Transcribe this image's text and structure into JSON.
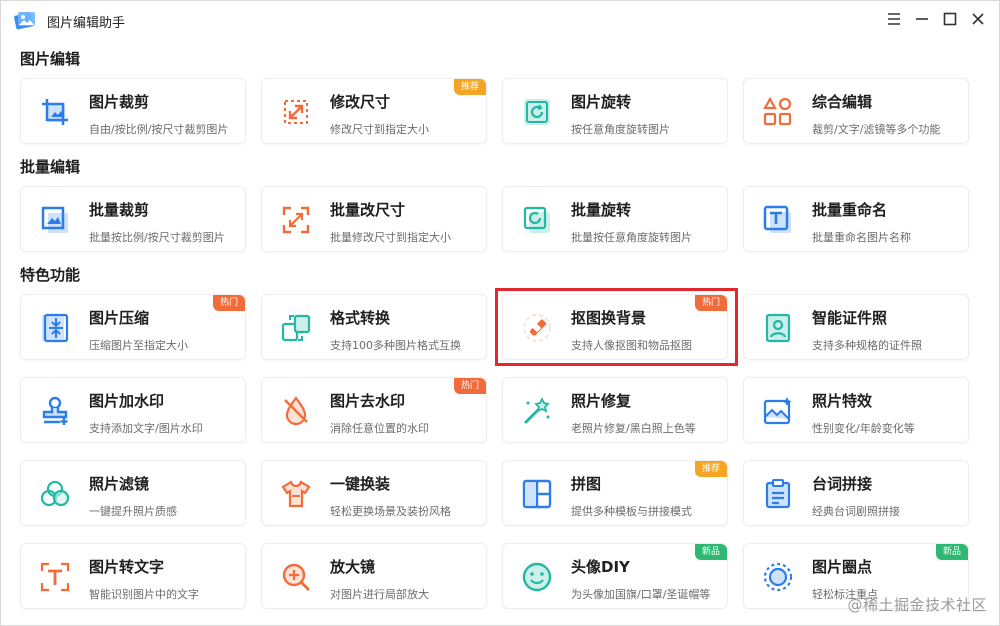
{
  "app": {
    "title": "图片编辑助手"
  },
  "sections": [
    {
      "title": "图片编辑"
    },
    {
      "title": "批量编辑"
    },
    {
      "title": "特色功能"
    }
  ],
  "cards": [
    {
      "name": "图片裁剪",
      "desc": "自由/按比例/按尺寸裁剪图片",
      "icon": "crop-icon"
    },
    {
      "name": "修改尺寸",
      "desc": "修改尺寸到指定大小",
      "icon": "resize-icon",
      "badge": "推荐"
    },
    {
      "name": "图片旋转",
      "desc": "按任意角度旋转图片",
      "icon": "rotate-icon"
    },
    {
      "name": "综合编辑",
      "desc": "裁剪/文字/滤镜等多个功能",
      "icon": "shapes-icon"
    },
    {
      "name": "批量裁剪",
      "desc": "批量按比例/按尺寸裁剪图片",
      "icon": "batch-crop-icon"
    },
    {
      "name": "批量改尺寸",
      "desc": "批量修改尺寸到指定大小",
      "icon": "batch-resize-icon"
    },
    {
      "name": "批量旋转",
      "desc": "批量按任意角度旋转图片",
      "icon": "batch-rotate-icon"
    },
    {
      "name": "批量重命名",
      "desc": "批量重命名图片名称",
      "icon": "rename-icon"
    },
    {
      "name": "图片压缩",
      "desc": "压缩图片至指定大小",
      "icon": "compress-icon",
      "badge": "热门"
    },
    {
      "name": "格式转换",
      "desc": "支持100多种图片格式互换",
      "icon": "convert-icon"
    },
    {
      "name": "抠图换背景",
      "desc": "支持人像抠图和物品抠图",
      "icon": "eraser-icon",
      "badge": "热门"
    },
    {
      "name": "智能证件照",
      "desc": "支持多种规格的证件照",
      "icon": "id-photo-icon"
    },
    {
      "name": "图片加水印",
      "desc": "支持添加文字/图片水印",
      "icon": "stamp-icon"
    },
    {
      "name": "图片去水印",
      "desc": "消除任意位置的水印",
      "icon": "remove-watermark-icon",
      "badge": "热门"
    },
    {
      "name": "照片修复",
      "desc": "老照片修复/黑白照上色等",
      "icon": "magic-wand-icon"
    },
    {
      "name": "照片特效",
      "desc": "性别变化/年龄变化等",
      "icon": "image-effect-icon"
    },
    {
      "name": "照片滤镜",
      "desc": "一键提升照片质感",
      "icon": "filter-icon"
    },
    {
      "name": "一键换装",
      "desc": "轻松更换场景及装扮风格",
      "icon": "tshirt-icon"
    },
    {
      "name": "拼图",
      "desc": "提供多种模板与拼接模式",
      "icon": "collage-icon",
      "badge": "推荐"
    },
    {
      "name": "台词拼接",
      "desc": "经典台词剧照拼接",
      "icon": "clipboard-icon"
    },
    {
      "name": "图片转文字",
      "desc": "智能识别图片中的文字",
      "icon": "ocr-icon"
    },
    {
      "name": "放大镜",
      "desc": "对图片进行局部放大",
      "icon": "magnifier-icon"
    },
    {
      "name": "头像DIY",
      "desc": "为头像加国旗/口罩/圣诞帽等",
      "icon": "smiley-icon",
      "badge": "新品"
    },
    {
      "name": "图片圈点",
      "desc": "轻松标注重点",
      "icon": "circle-mark-icon",
      "badge": "新品"
    }
  ],
  "watermark": "@稀土掘金技术社区",
  "colors": {
    "blue": "#2b7de9",
    "orange": "#f26b3a",
    "teal": "#22b8a5",
    "highlight": "#e0282e"
  }
}
